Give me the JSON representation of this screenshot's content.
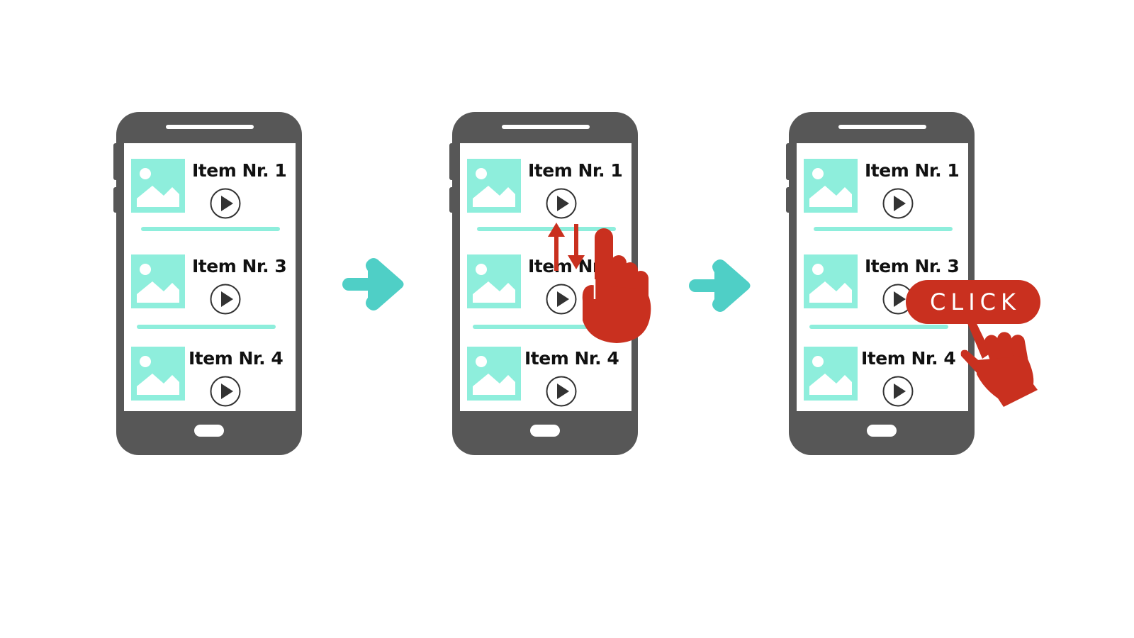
{
  "steps": [
    {
      "items": [
        {
          "label": "Item Nr. 1"
        },
        {
          "label": "Item Nr. 3"
        },
        {
          "label": "Item Nr. 4"
        }
      ]
    },
    {
      "items": [
        {
          "label": "Item Nr. 1"
        },
        {
          "label": "Item Nr. 3"
        },
        {
          "label": "Item Nr. 4"
        }
      ]
    },
    {
      "items": [
        {
          "label": "Item Nr. 1"
        },
        {
          "label": "Item Nr. 3"
        },
        {
          "label": "Item Nr. 4"
        }
      ]
    }
  ],
  "click_label": "CLICK",
  "icons": {
    "thumbnail": "image-placeholder-icon",
    "play": "play-icon",
    "flow": "arrow-right-icon",
    "scroll": "scroll-hand-icon",
    "tap": "tap-hand-icon"
  },
  "colors": {
    "phone_body": "#575757",
    "accent": "#8eeedc",
    "arrow": "#4fcfc6",
    "gesture": "#c9301f"
  }
}
